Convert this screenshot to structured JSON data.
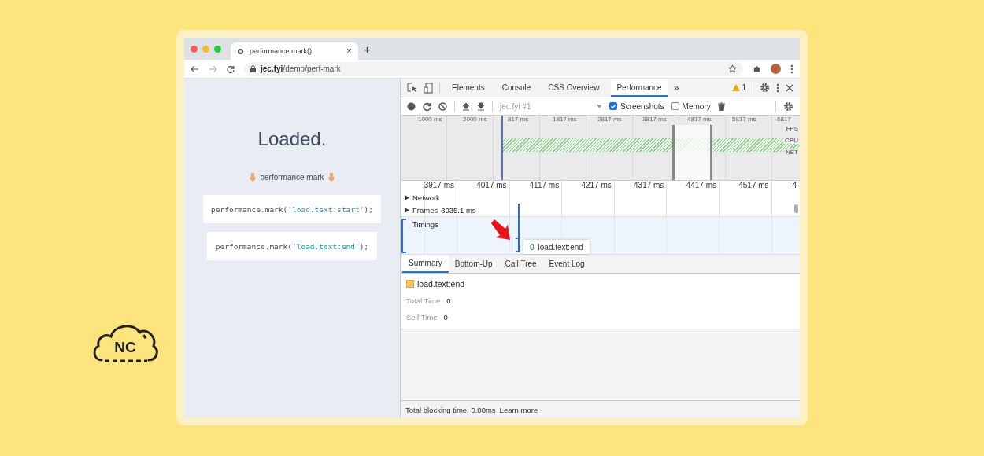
{
  "logo": {
    "text": "NC"
  },
  "browser": {
    "tab_title": "performance.mark()",
    "tab_close": "×",
    "new_tab": "+",
    "url_host": "jec.fyi",
    "url_path": "/demo/perf-mark"
  },
  "page": {
    "heading": "Loaded.",
    "caption": "performance mark",
    "code": [
      {
        "call": "performance.mark(",
        "argument": "'load.text:start'",
        "close": ");"
      },
      {
        "call": "performance.mark(",
        "argument": "'load.text:end'",
        "close": ");"
      }
    ]
  },
  "devtools": {
    "tabs": [
      {
        "label": "Elements",
        "selected": false
      },
      {
        "label": "Console",
        "selected": false
      },
      {
        "label": "CSS Overview",
        "selected": false
      },
      {
        "label": "Performance",
        "selected": true
      }
    ],
    "more_tabs": "»",
    "warnings": "1",
    "profile_select": "jec.fyi #1",
    "checkboxes": [
      {
        "label": "Screenshots",
        "checked": true
      },
      {
        "label": "Memory",
        "checked": false
      }
    ],
    "overview_ticks": [
      "1000 ms",
      "2000 ms",
      "817 ms",
      "1817 ms",
      "2817 ms",
      "3817 ms",
      "4817 ms",
      "5817 ms",
      "6817"
    ],
    "overview_tracks": [
      "FPS",
      "CPU",
      "NET"
    ],
    "ruler_ticks": [
      "3917 ms",
      "4017 ms",
      "4117 ms",
      "4217 ms",
      "4317 ms",
      "4417 ms",
      "4517 ms",
      "4"
    ],
    "tracks": [
      {
        "kind": "collapsed",
        "label": "Network"
      },
      {
        "kind": "collapsed",
        "label": "Frames",
        "value": "3935.1 ms"
      },
      {
        "kind": "group",
        "label": "Timings"
      }
    ],
    "mark_tooltip": {
      "value": "0",
      "label": "load.text:end"
    },
    "bottom_tabs": [
      {
        "label": "Summary",
        "selected": true
      },
      {
        "label": "Bottom-Up",
        "selected": false
      },
      {
        "label": "Call Tree",
        "selected": false
      },
      {
        "label": "Event Log",
        "selected": false
      }
    ],
    "summary": {
      "title": "load.text:end",
      "color": "#f5c46a",
      "rows": [
        {
          "label": "Total Time",
          "value": "0"
        },
        {
          "label": "Self Time",
          "value": "0"
        }
      ]
    },
    "status": {
      "text": "Total blocking time: 0.00ms",
      "link": "Learn more"
    }
  }
}
